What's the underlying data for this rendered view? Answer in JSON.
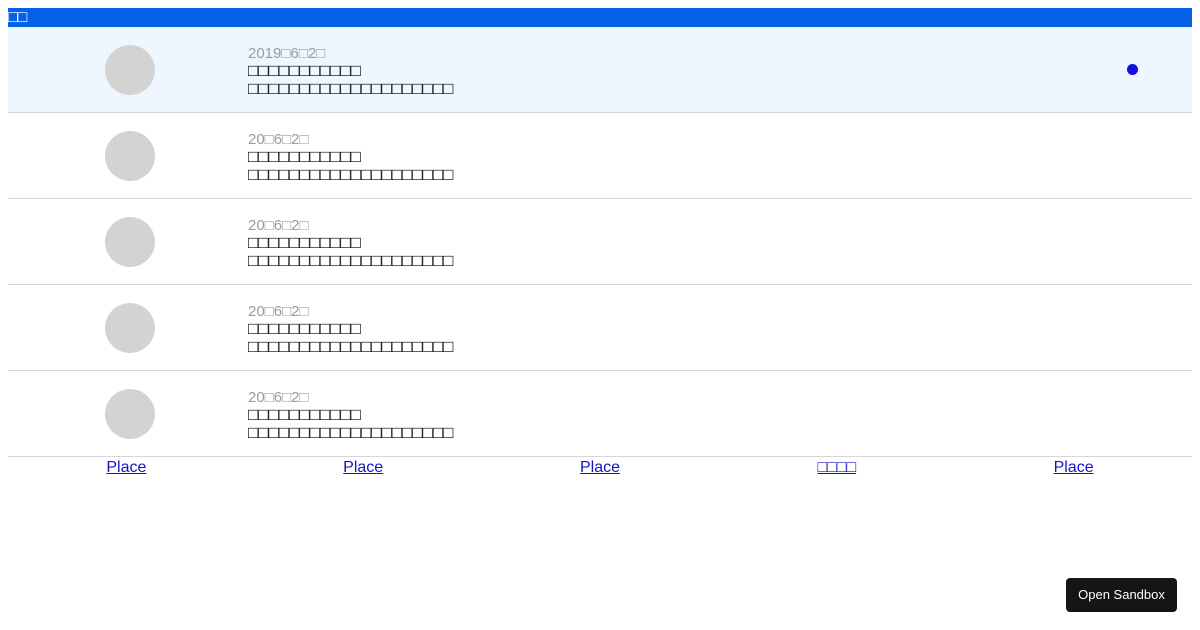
{
  "header": {
    "title": "□□"
  },
  "notifications": [
    {
      "date": "2019□6□2□",
      "title": "□□□□□□□□□□□",
      "body": "□□□□□□□□□□□□□□□□□□□□",
      "unread": true
    },
    {
      "date": "20□6□2□",
      "title": "□□□□□□□□□□□",
      "body": "□□□□□□□□□□□□□□□□□□□□",
      "unread": false
    },
    {
      "date": "20□6□2□",
      "title": "□□□□□□□□□□□",
      "body": "□□□□□□□□□□□□□□□□□□□□",
      "unread": false
    },
    {
      "date": "20□6□2□",
      "title": "□□□□□□□□□□□",
      "body": "□□□□□□□□□□□□□□□□□□□□",
      "unread": false
    },
    {
      "date": "20□6□2□",
      "title": "□□□□□□□□□□□",
      "body": "□□□□□□□□□□□□□□□□□□□□",
      "unread": false
    }
  ],
  "tabs": [
    {
      "label": "Place"
    },
    {
      "label": "Place"
    },
    {
      "label": "Place"
    },
    {
      "label": "□□□□"
    },
    {
      "label": "Place"
    }
  ],
  "sandbox": {
    "label": "Open Sandbox"
  },
  "colors": {
    "header_bg": "#0562e8",
    "unread_bg": "#eef6ff",
    "unread_dot": "#1010e0",
    "link": "#1414c8"
  }
}
